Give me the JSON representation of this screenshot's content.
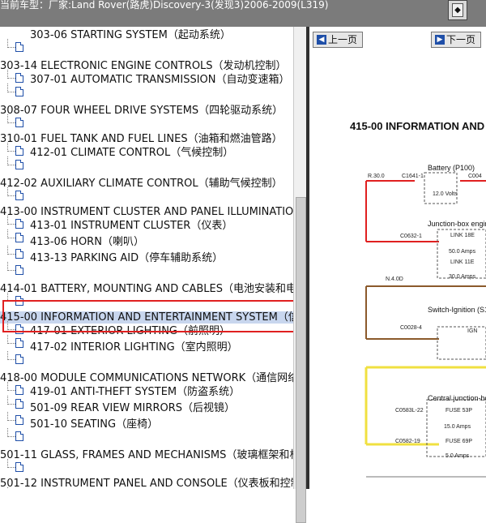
{
  "header": {
    "breadcrumb": "当前车型：厂家:Land Rover(路虎)Discovery-3(发现3)2006-2009(L319)",
    "corner_button_glyph": "◆"
  },
  "toc": {
    "items": [
      {
        "level": "child",
        "text": "303-06 STARTING SYSTEM（起动系统）"
      },
      {
        "level": "parent",
        "text": "303-14 ELECTRONIC ENGINE CONTROLS（发动机控制）"
      },
      {
        "level": "child",
        "text": "307-01 AUTOMATIC TRANSMISSION（自动变速箱）"
      },
      {
        "level": "parent",
        "text": "308-07 FOUR WHEEL DRIVE SYSTEMS（四轮驱动系统）"
      },
      {
        "level": "parent",
        "text": "310-01 FUEL TANK AND FUEL LINES（油箱和燃油管路）"
      },
      {
        "level": "child",
        "text": "412-01 CLIMATE CONTROL（气候控制）"
      },
      {
        "level": "parent",
        "text": "412-02 AUXILIARY CLIMATE CONTROL（辅助气候控制）"
      },
      {
        "level": "parent",
        "text": "413-00 INSTRUMENT CLUSTER AND PANEL ILLUMINATION"
      },
      {
        "level": "child",
        "text": "413-01 INSTRUMENT CLUSTER（仪表）"
      },
      {
        "level": "child",
        "text": "413-06 HORN（喇叭）"
      },
      {
        "level": "child",
        "text": "413-13 PARKING AID（停车辅助系统）"
      },
      {
        "level": "parent",
        "text": "414-01 BATTERY, MOUNTING AND CABLES（电池安装和电"
      },
      {
        "level": "parent",
        "text": "415-00 INFORMATION AND ENTERTAINMENT SYSTEM（信",
        "selected": true
      },
      {
        "level": "child",
        "text": "417-01 EXTERIOR LIGHTING（前照明）"
      },
      {
        "level": "child",
        "text": "417-02 INTERIOR LIGHTING（室内照明）"
      },
      {
        "level": "parent",
        "text": "418-00 MODULE COMMUNICATIONS NETWORK（通信网络"
      },
      {
        "level": "child",
        "text": "419-01 ANTI-THEFT SYSTEM（防盗系统）"
      },
      {
        "level": "child",
        "text": "501-09 REAR VIEW MIRRORS（后视镜）"
      },
      {
        "level": "child",
        "text": "501-10 SEATING（座椅）"
      },
      {
        "level": "parent",
        "text": "501-11 GLASS, FRAMES AND MECHANISMS（玻璃框架和机"
      },
      {
        "level": "parent",
        "text": "501-12 INSTRUMENT PANEL AND CONSOLE（仪表板和控制"
      }
    ]
  },
  "viewer": {
    "prev_label": "上一页",
    "next_label": "下一页",
    "doc_title": "415-00 INFORMATION AND",
    "wiring": {
      "battery": "Battery (P100)",
      "r30": "R.30.0",
      "c1641": "C1641-1",
      "c004": "C004",
      "volts": "12.0 Volts",
      "junction_box": "Junction-box engin",
      "c0632": "C0632-1",
      "link18e": "LINK 18E",
      "amps50": "50.0 Amps",
      "link11e": "LINK 11E",
      "amps30": "30.0 Amps",
      "n40d": "N.4.0D",
      "switch": "Switch-Ignition (S1",
      "c0028": "C0028-4",
      "ign": "IGN",
      "central_box": "Central junction-bo",
      "c0583": "C0583L-22",
      "fuse53p": "FUSE 53P",
      "amps15": "15.0 Amps",
      "c0582": "C0582-19",
      "fuse69p": "FUSE 69P",
      "amps5": "5.0 Amps"
    }
  }
}
